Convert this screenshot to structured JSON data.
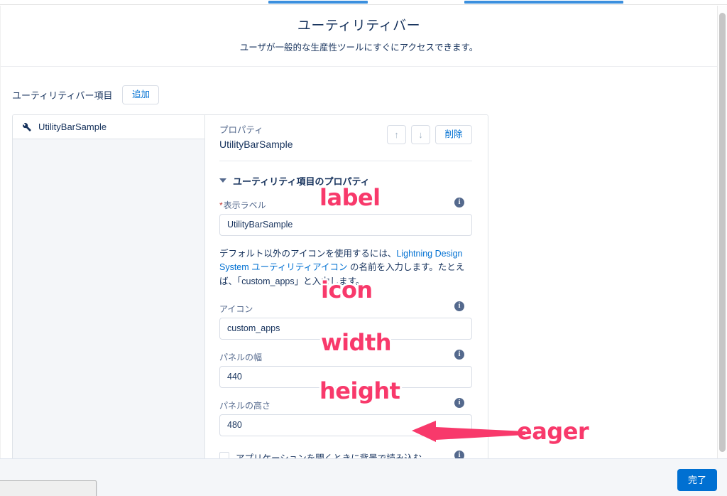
{
  "browser": {
    "tabs": [
      {
        "name": "tab-underline-1"
      },
      {
        "name": "tab-underline-2"
      }
    ],
    "download_shelf_item": ""
  },
  "header": {
    "title": "ユーティリティバー",
    "subtitle": "ユーザが一般的な生産性ツールにすぐにアクセスできます。"
  },
  "toolbar": {
    "items_label": "ユーティリティバー項目",
    "add_label": "追加"
  },
  "item_list": {
    "items": [
      {
        "label": "UtilityBarSample",
        "icon": "wrench-icon"
      }
    ]
  },
  "properties": {
    "kicker": "プロパティ",
    "name": "UtilityBarSample",
    "move_up_label": "↑",
    "move_down_label": "↓",
    "delete_label": "削除",
    "section_title": "ユーティリティ項目のプロパティ",
    "fields": [
      {
        "label": "表示ラベル",
        "required": true,
        "value": "UtilityBarSample",
        "placeholder": "",
        "info": "i"
      },
      {
        "label": "アイコン",
        "required": false,
        "value": "custom_apps",
        "placeholder": "",
        "info": "i"
      },
      {
        "label": "パネルの幅",
        "required": false,
        "value": "440",
        "placeholder": "",
        "info": "i"
      },
      {
        "label": "パネルの高さ",
        "required": false,
        "value": "480",
        "placeholder": "",
        "info": "i"
      }
    ],
    "help_text": {
      "part1": "デフォルト以外のアイコンを使用するには、",
      "link1": "Lightning Design System ユーティリティアイコン",
      "part2": " の名前を入力します。たとえば、「custom_apps」と入力します。"
    },
    "checkbox": {
      "label": "アプリケーションを開くときに背景で読み込む",
      "checked": false,
      "info": "i"
    }
  },
  "footer": {
    "done_label": "完了"
  },
  "annotations": [
    {
      "text": "label",
      "color": "#f8396b"
    },
    {
      "text": "icon",
      "color": "#f8396b"
    },
    {
      "text": "width",
      "color": "#f8396b"
    },
    {
      "text": "height",
      "color": "#f8396b"
    },
    {
      "text": "eager",
      "color": "#f8396b"
    }
  ],
  "colors": {
    "accent_blue": "#0070d2",
    "tab_blue": "#3b8fde",
    "annotation_pink": "#f8396b",
    "text_navy": "#16325c",
    "text_muted": "#54698d",
    "panel_gray": "#f4f6f9"
  }
}
